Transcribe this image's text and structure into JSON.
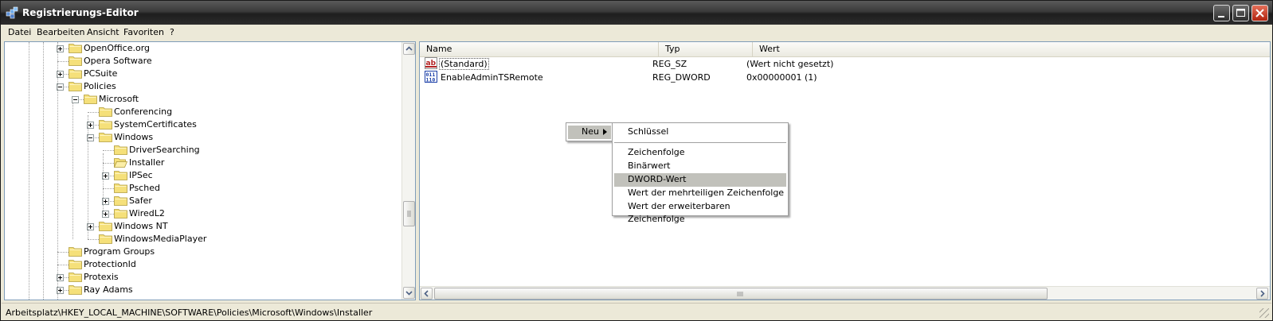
{
  "window": {
    "title": "Registrierungs-Editor"
  },
  "menu": [
    "Datei",
    "Bearbeiten",
    "Ansicht",
    "Favoriten",
    "?"
  ],
  "tree": [
    {
      "label": "OpenOffice.org",
      "level": 0,
      "expander": "plus"
    },
    {
      "label": "Opera Software",
      "level": 0,
      "expander": "none"
    },
    {
      "label": "PCSuite",
      "level": 0,
      "expander": "plus"
    },
    {
      "label": "Policies",
      "level": 0,
      "expander": "minus"
    },
    {
      "label": "Microsoft",
      "level": 1,
      "expander": "minus"
    },
    {
      "label": "Conferencing",
      "level": 2,
      "expander": "none"
    },
    {
      "label": "SystemCertificates",
      "level": 2,
      "expander": "plus"
    },
    {
      "label": "Windows",
      "level": 2,
      "expander": "minus"
    },
    {
      "label": "DriverSearching",
      "level": 3,
      "expander": "none"
    },
    {
      "label": "Installer",
      "level": 3,
      "expander": "none",
      "selected": true
    },
    {
      "label": "IPSec",
      "level": 3,
      "expander": "plus"
    },
    {
      "label": "Psched",
      "level": 3,
      "expander": "none"
    },
    {
      "label": "Safer",
      "level": 3,
      "expander": "plus"
    },
    {
      "label": "WiredL2",
      "level": 3,
      "expander": "plus"
    },
    {
      "label": "Windows NT",
      "level": 2,
      "expander": "plus"
    },
    {
      "label": "WindowsMediaPlayer",
      "level": 2,
      "expander": "none"
    },
    {
      "label": "Program Groups",
      "level": 0,
      "expander": "none"
    },
    {
      "label": "ProtectionId",
      "level": 0,
      "expander": "none"
    },
    {
      "label": "Protexis",
      "level": 0,
      "expander": "plus"
    },
    {
      "label": "Ray Adams",
      "level": 0,
      "expander": "plus"
    }
  ],
  "list": {
    "columns": [
      "Name",
      "Typ",
      "Wert"
    ],
    "rows": [
      {
        "name": "(Standard)",
        "type": "REG_SZ",
        "value": "(Wert nicht gesetzt)",
        "icon": "string-value-icon"
      },
      {
        "name": "EnableAdminTSRemote",
        "type": "REG_DWORD",
        "value": "0x00000001 (1)",
        "icon": "binary-value-icon"
      }
    ]
  },
  "context_menu": {
    "parent_item": "Neu",
    "submenu": [
      "Schlüssel",
      "Zeichenfolge",
      "Binärwert",
      "DWORD-Wert",
      "Wert der mehrteiligen Zeichenfolge",
      "Wert der erweiterbaren Zeichenfolge"
    ],
    "highlighted": "DWORD-Wert"
  },
  "status": "Arbeitsplatz\\HKEY_LOCAL_MACHINE\\SOFTWARE\\Policies\\Microsoft\\Windows\\Installer",
  "colors": {
    "folder": "#f5e07a",
    "folder_outline": "#b09a3a",
    "highlight": "#c1c1bb"
  }
}
